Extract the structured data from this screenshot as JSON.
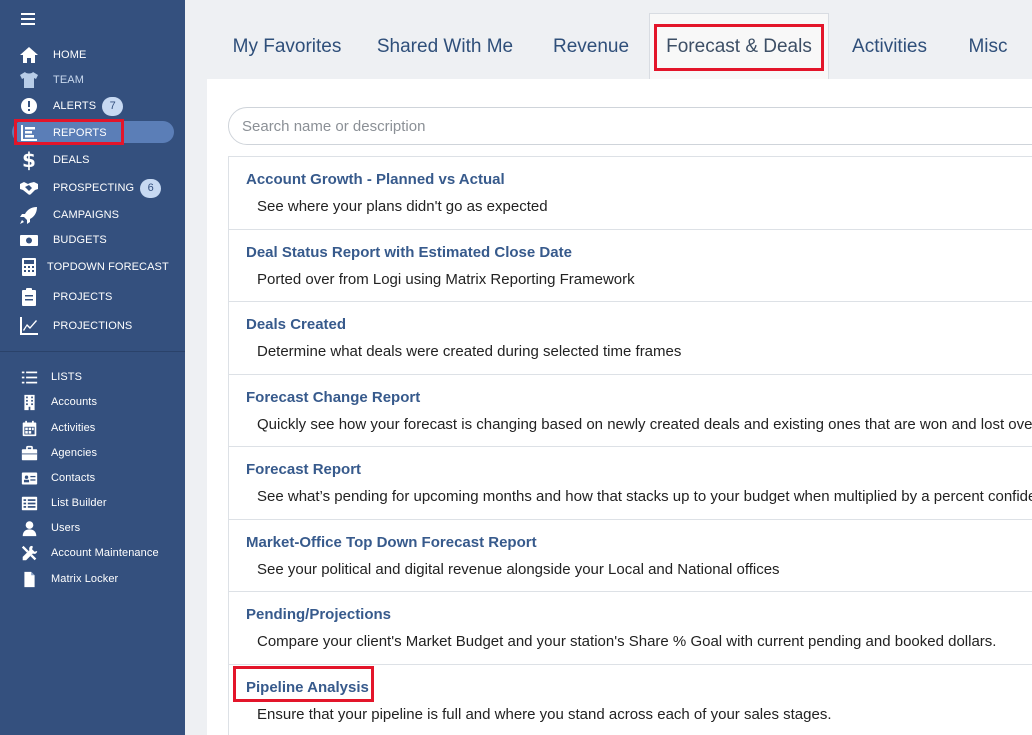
{
  "sidebar": {
    "nav": [
      {
        "label": "HOME",
        "icon": "home-icon"
      },
      {
        "label": "TEAM",
        "icon": "shirt-icon"
      },
      {
        "label": "ALERTS",
        "icon": "alert-icon",
        "badge": "7"
      },
      {
        "label": "REPORTS",
        "icon": "report-icon"
      },
      {
        "label": "DEALS",
        "icon": "dollar-icon"
      },
      {
        "label": "PROSPECTING",
        "icon": "handshake-icon",
        "badge": "6"
      },
      {
        "label": "CAMPAIGNS",
        "icon": "rocket-icon"
      },
      {
        "label": "BUDGETS",
        "icon": "money-icon"
      },
      {
        "label": "TOPDOWN FORECAST",
        "icon": "calculator-icon"
      },
      {
        "label": "PROJECTS",
        "icon": "clipboard-icon"
      },
      {
        "label": "PROJECTIONS",
        "icon": "line-chart-icon"
      }
    ],
    "lists": [
      {
        "label": "LISTS",
        "icon": "list-icon"
      },
      {
        "label": "Accounts",
        "icon": "building-icon"
      },
      {
        "label": "Activities",
        "icon": "calendar-icon"
      },
      {
        "label": "Agencies",
        "icon": "briefcase-icon"
      },
      {
        "label": "Contacts",
        "icon": "contact-card-icon"
      },
      {
        "label": "List Builder",
        "icon": "list-builder-icon"
      },
      {
        "label": "Users",
        "icon": "user-icon"
      },
      {
        "label": "Account Maintenance",
        "icon": "tools-icon"
      },
      {
        "label": "Matrix Locker",
        "icon": "file-icon"
      }
    ]
  },
  "tabs": [
    "My Favorites",
    "Shared With Me",
    "Revenue",
    "Forecast & Deals",
    "Activities",
    "Misc"
  ],
  "active_tab": "Forecast & Deals",
  "search": {
    "placeholder": "Search name or description"
  },
  "reports": [
    {
      "title": "Account Growth - Planned vs Actual",
      "description": "See where your plans didn't go as expected"
    },
    {
      "title": "Deal Status Report with Estimated Close Date",
      "description": "Ported over from Logi using Matrix Reporting Framework"
    },
    {
      "title": "Deals Created",
      "description": "Determine what deals were created during selected time frames"
    },
    {
      "title": "Forecast Change Report",
      "description": "Quickly see how your forecast is changing based on newly created deals and existing ones that are won and lost over"
    },
    {
      "title": "Forecast Report",
      "description": "See what’s pending for upcoming months and how that stacks up to your budget when multiplied by a percent confide"
    },
    {
      "title": "Market-Office Top Down Forecast Report",
      "description": "See your political and digital revenue alongside your Local and National offices"
    },
    {
      "title": "Pending/Projections",
      "description": "Compare your client's Market Budget and your station's Share % Goal with current pending and booked dollars."
    },
    {
      "title": "Pipeline Analysis",
      "description": "Ensure that your pipeline is full and where you stand across each of your sales stages."
    }
  ],
  "colors": {
    "sidebar": "#34507e",
    "active_pill": "#5b7eb7",
    "highlight": "#e3152a",
    "link": "#375a8c"
  }
}
